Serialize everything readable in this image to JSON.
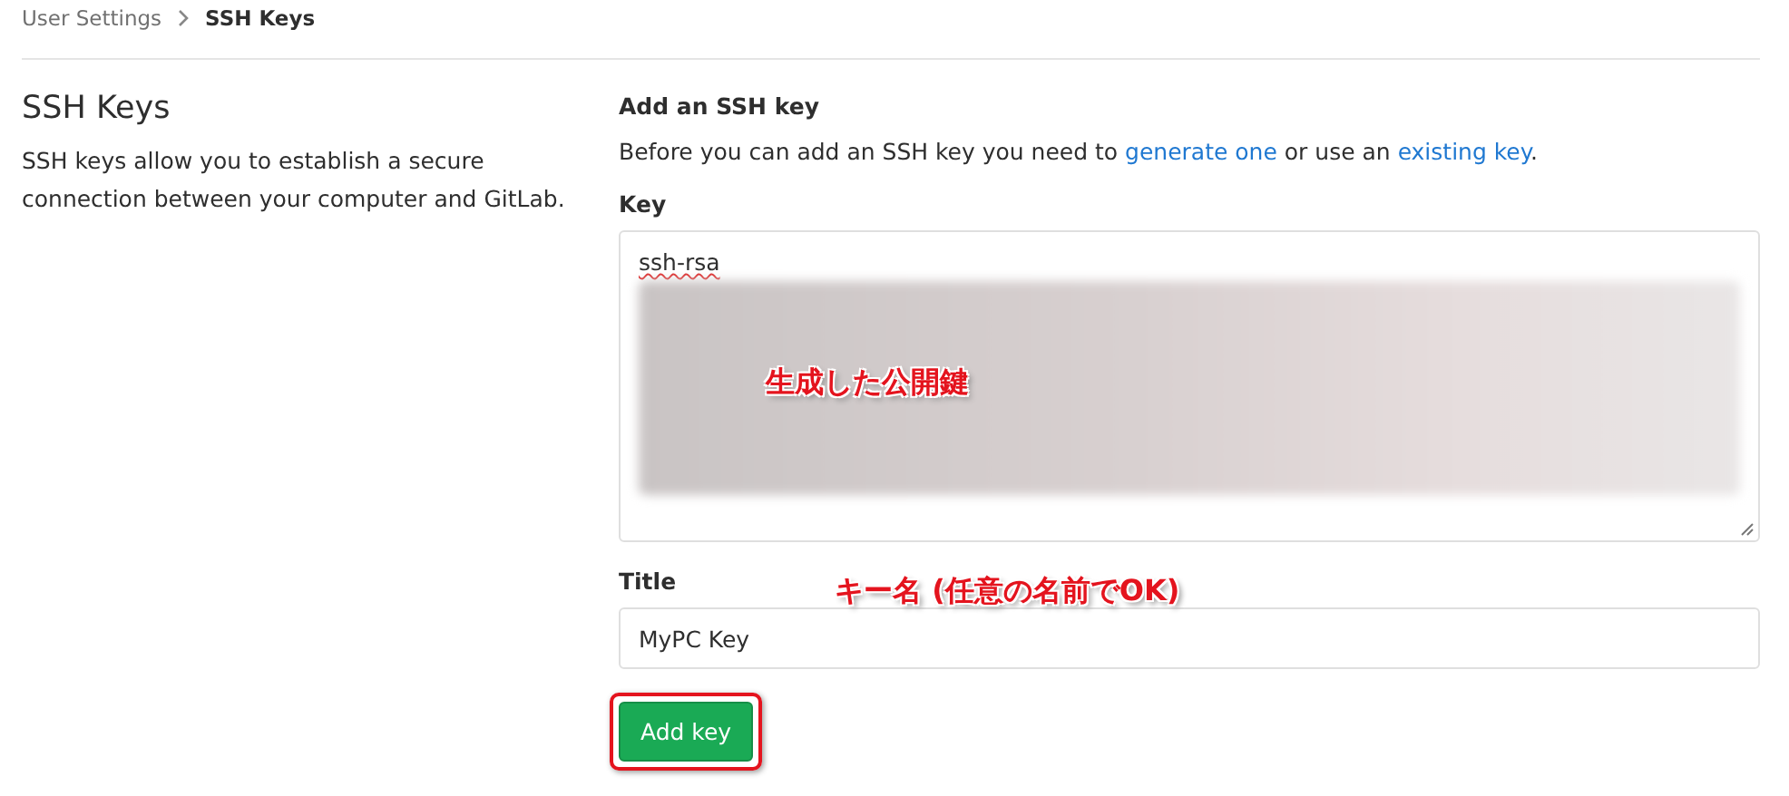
{
  "breadcrumb": [
    {
      "label": "User Settings",
      "current": false
    },
    {
      "label": "SSH Keys",
      "current": true
    }
  ],
  "sidebar": {
    "title": "SSH Keys",
    "description": "SSH keys allow you to establish a secure connection between your computer and GitLab."
  },
  "form": {
    "heading": "Add an SSH key",
    "intro": [
      {
        "kind": "text",
        "text": "Before you can add an SSH key you need to "
      },
      {
        "kind": "link",
        "text": "generate one"
      },
      {
        "kind": "text",
        "text": " or use an "
      },
      {
        "kind": "link",
        "text": "existing key"
      },
      {
        "kind": "text",
        "text": "."
      }
    ],
    "key_field": {
      "label": "Key",
      "value": "ssh-rsa"
    },
    "title_field": {
      "label": "Title",
      "value": "MyPC Key"
    },
    "submit": {
      "label": "Add key"
    }
  },
  "annotations": [
    {
      "kind": "key",
      "text": "生成した公開鍵"
    },
    {
      "kind": "title",
      "text": "キー名 (任意の名前でOK)"
    }
  ]
}
